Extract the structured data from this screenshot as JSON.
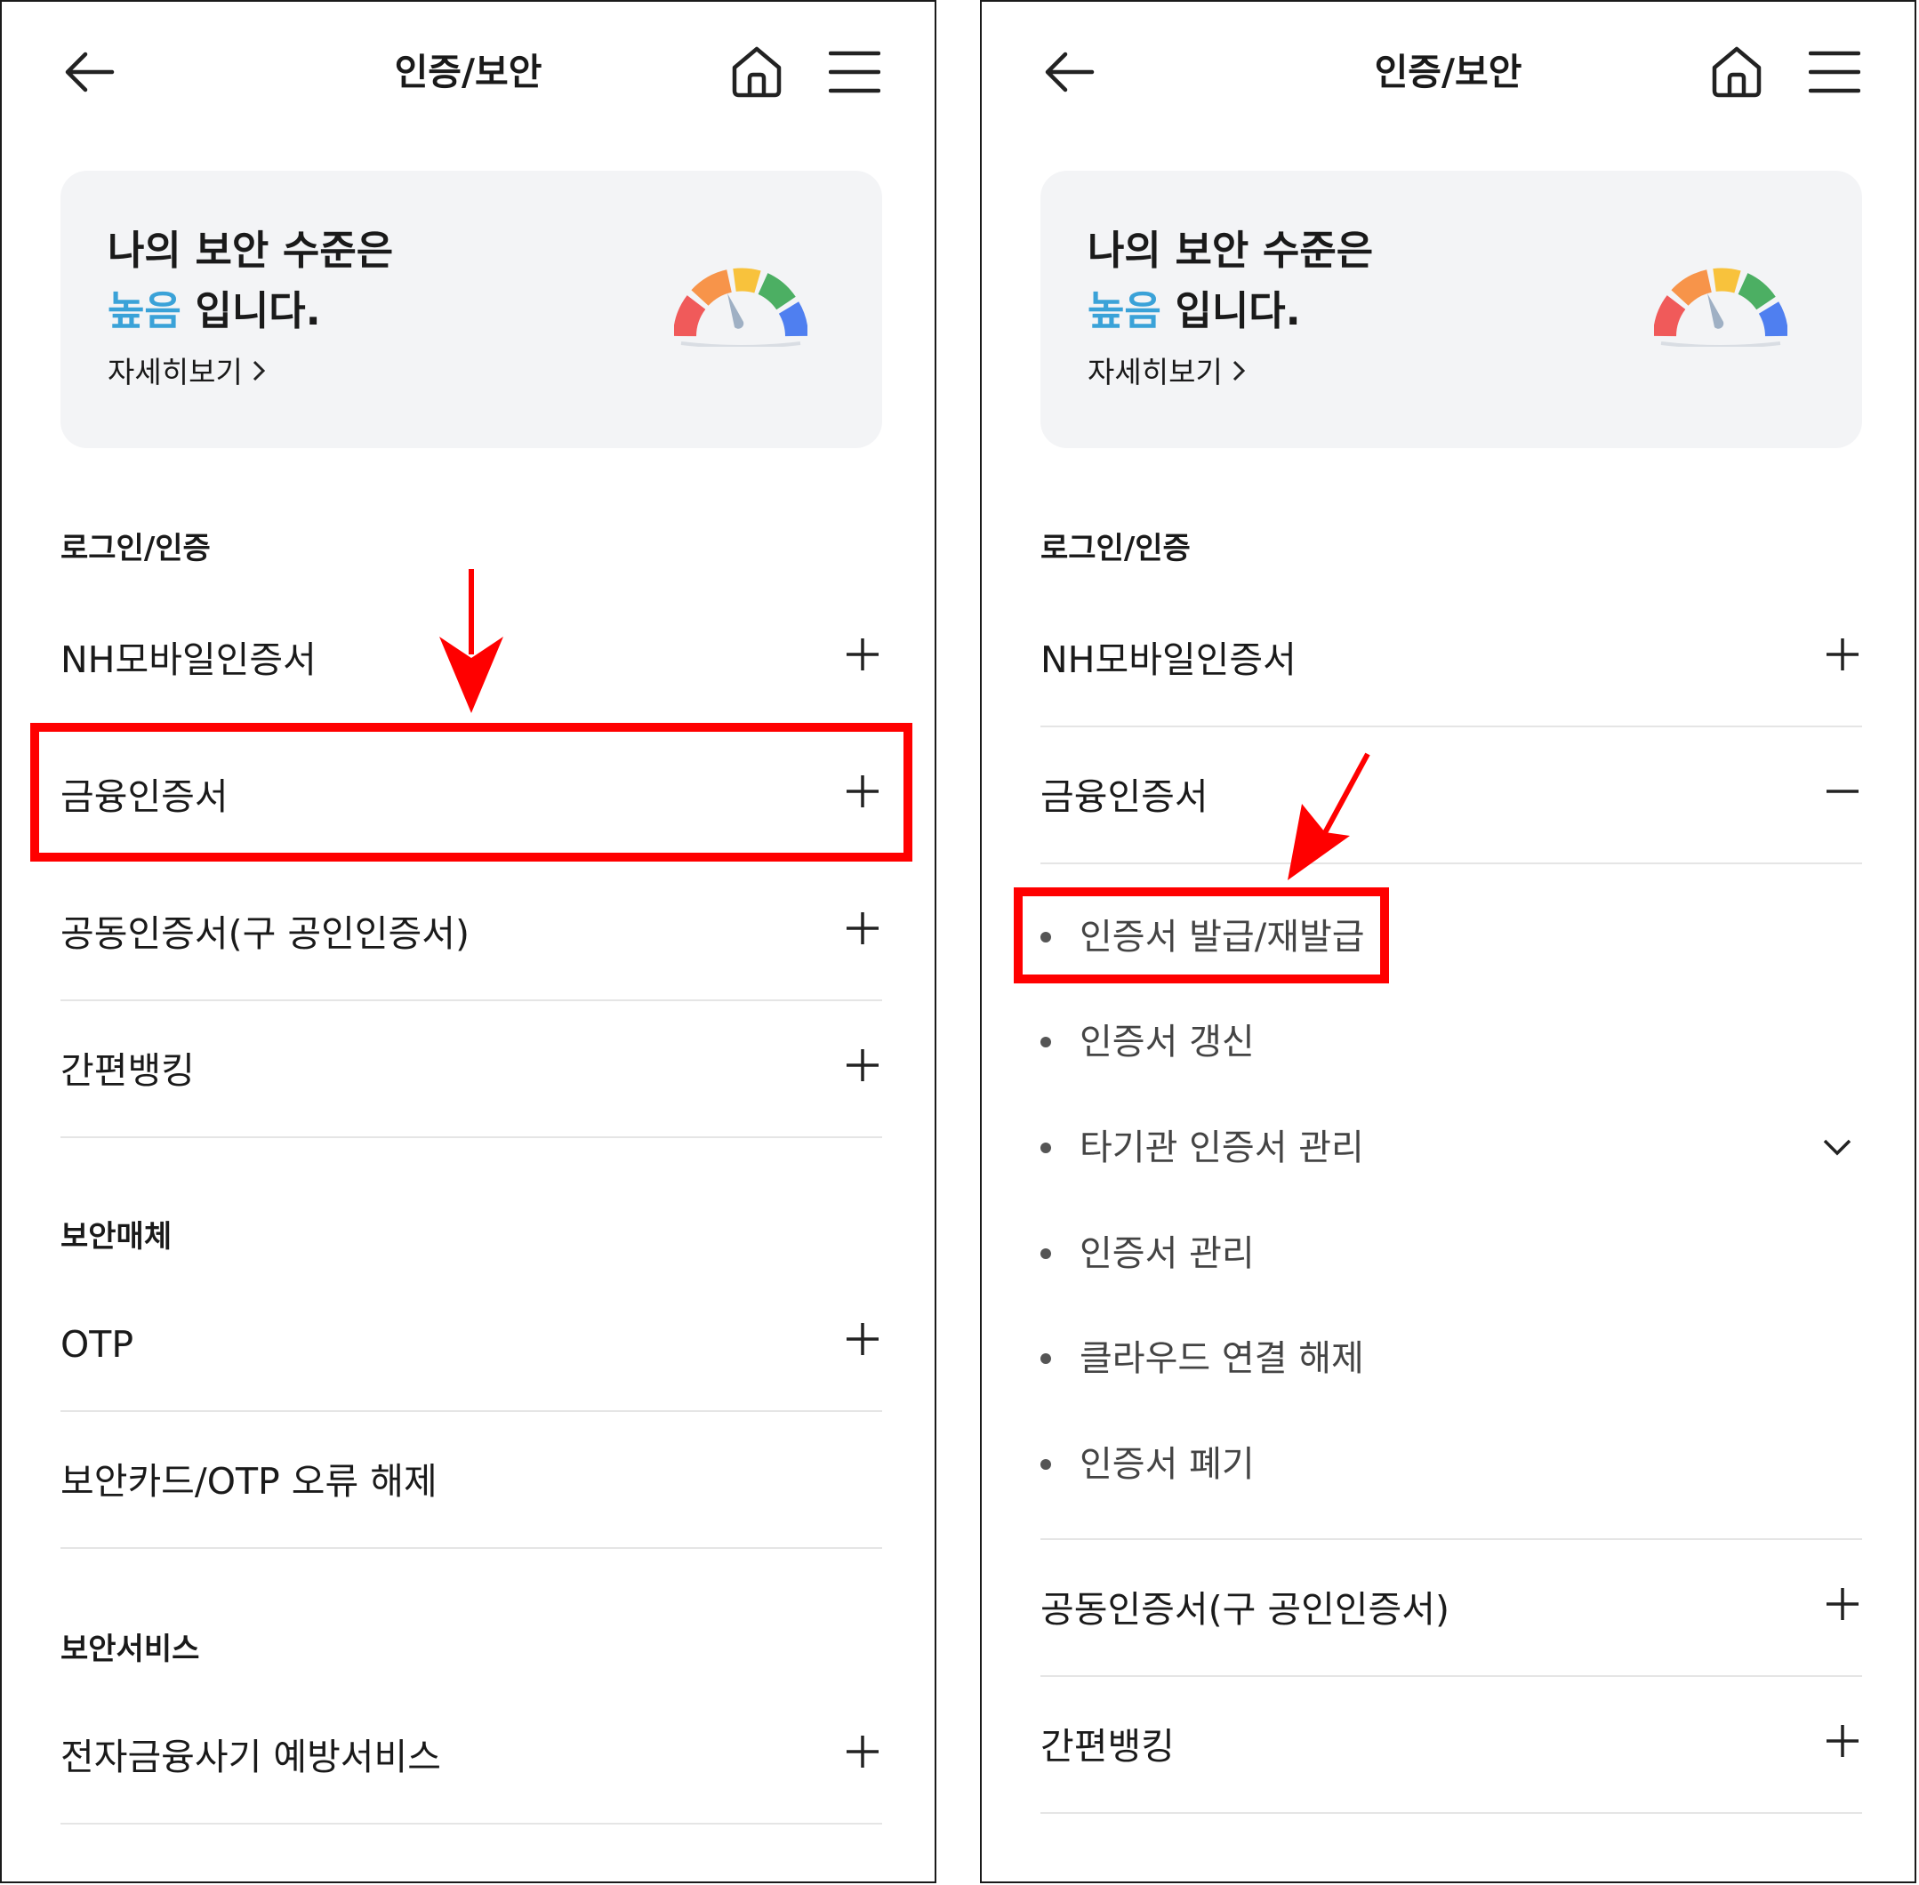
{
  "header": {
    "title": "인증/보안"
  },
  "security_card": {
    "line1": "나의 보안 수준은",
    "level": "높음",
    "line2_suffix": " 입니다.",
    "detail_link": "자세히보기"
  },
  "left_screen": {
    "section_login": "로그인/인증",
    "section_media": "보안매체",
    "section_service": "보안서비스",
    "items": {
      "nh_mobile": "NH모바일인증서",
      "financial_cert": "금융인증서",
      "joint_cert": "공동인증서(구 공인인증서)",
      "simple_banking": "간편뱅킹",
      "otp": "OTP",
      "otp_error_release": "보안카드/OTP 오류 해제",
      "fraud_prevention": "전자금융사기 예방서비스"
    }
  },
  "right_screen": {
    "section_login": "로그인/인증",
    "items": {
      "nh_mobile": "NH모바일인증서",
      "financial_cert": "금융인증서",
      "joint_cert": "공동인증서(구 공인인증서)",
      "simple_banking": "간편뱅킹"
    },
    "sub_items": {
      "issue": "인증서 발급/재발급",
      "renew": "인증서 갱신",
      "other_institution": "타기관 인증서 관리",
      "manage": "인증서 관리",
      "cloud_disconnect": "클라우드 연결 해제",
      "revoke": "인증서 폐기"
    }
  },
  "colors": {
    "accent": "#3aa2d8",
    "highlight": "#ff0000",
    "card_bg": "#f3f4f6",
    "divider": "#e5e5e5"
  },
  "icons": [
    "back-arrow-icon",
    "home-icon",
    "hamburger-menu-icon",
    "gauge-icon",
    "plus-icon",
    "minus-icon",
    "chevron-right-icon",
    "chevron-down-icon"
  ]
}
